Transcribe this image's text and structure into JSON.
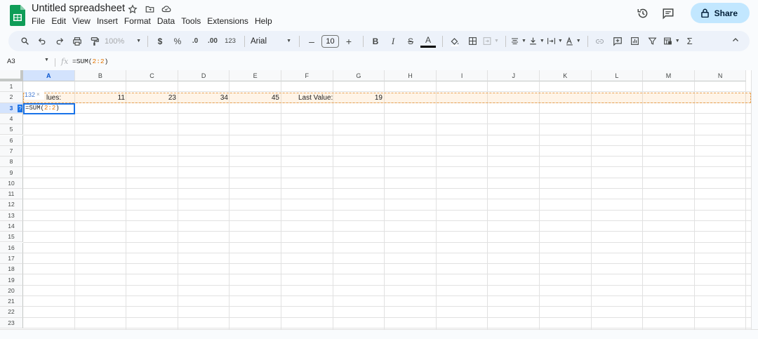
{
  "doc": {
    "title": "Untitled spreadsheet"
  },
  "menu": [
    "File",
    "Edit",
    "View",
    "Insert",
    "Format",
    "Data",
    "Tools",
    "Extensions",
    "Help"
  ],
  "share": {
    "label": "Share"
  },
  "toolbar": {
    "zoom": "100%",
    "currency": "$",
    "percent": "%",
    "dec_decrease": ".0",
    "dec_increase": ".00",
    "number_format": "123",
    "font": "Arial",
    "font_size": "10",
    "minus": "–",
    "plus": "+",
    "bold": "B",
    "italic": "I",
    "strike": "S",
    "text_color": "A",
    "sigma": "Σ"
  },
  "formula_bar": {
    "cell_ref": "A3",
    "fx": "fx",
    "prefix": "=SUM(",
    "ref": "2:2",
    "suffix": ")"
  },
  "grid": {
    "columns": [
      "A",
      "B",
      "C",
      "D",
      "E",
      "F",
      "G",
      "H",
      "I",
      "J",
      "K",
      "L",
      "M",
      "N"
    ],
    "rows": [
      "1",
      "2",
      "3",
      "4",
      "5",
      "6",
      "7",
      "8",
      "9",
      "10",
      "11",
      "12",
      "13",
      "14",
      "15",
      "16",
      "17",
      "18",
      "19",
      "20",
      "21",
      "22",
      "23"
    ],
    "selected_col": "A",
    "selected_row": "3",
    "row2": {
      "a": "lues:",
      "b": "11",
      "c": "23",
      "d": "34",
      "e": "45",
      "f": "Last Value:",
      "g": "19"
    },
    "active_cell": {
      "prefix": "=SUM(",
      "ref": "2:2",
      "suffix": ")"
    },
    "tooltip": {
      "value": "132",
      "close": "×"
    },
    "hint": "?"
  },
  "colors": {
    "accent": "#1a73e8",
    "share_bg": "#c2e7ff",
    "ref": "#e37400",
    "toolbar_bg": "#edf2fa"
  }
}
